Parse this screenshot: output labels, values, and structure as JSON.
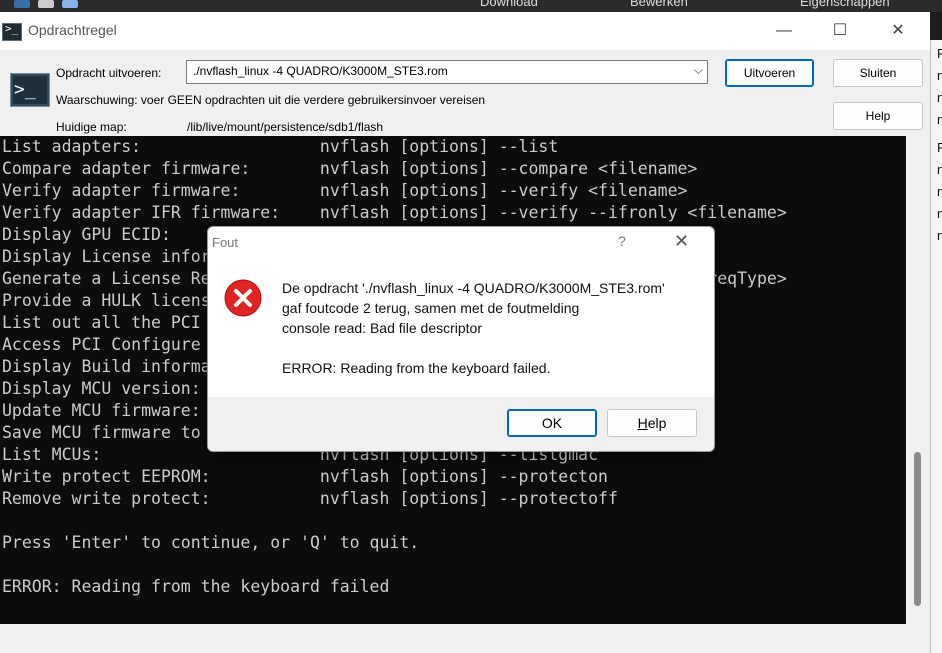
{
  "background": {
    "taskbar_items": [
      "Download",
      "Bewerken",
      "Eigenschappen"
    ],
    "right_window_letters": [
      "R",
      "n",
      "n",
      "n",
      "F",
      "n",
      "n",
      "n",
      "n"
    ]
  },
  "window": {
    "title": "Opdrachtregel",
    "minimize_icon": "—",
    "maximize_icon": "☐",
    "close_icon": "✕"
  },
  "form": {
    "run_label": "Opdracht uitvoeren:",
    "command_value": "./nvflash_linux -4 QUADRO/K3000M_STE3.rom",
    "warning": "Waarschuwing: voer GEEN opdrachten uit die verdere gebruikersinvoer vereisen",
    "dir_label": "Huidige map:",
    "dir_value": "/lib/live/mount/persistence/sdb1/flash",
    "run_button": "Uitvoeren",
    "close_button": "Sluiten",
    "help_button": "Help"
  },
  "terminal": {
    "lines": [
      "List adapters:                  nvflash [options] --list",
      "Compare adapter firmware:       nvflash [options] --compare <filename>",
      "Verify adapter firmware:        nvflash [options] --verify <filename>",
      "Verify adapter IFR firmware:    nvflash [options] --verify --ifronly <filename>",
      "Display GPU ECID:               nvflash [options] --ecid",
      "Display License information:    nvflash [options] --licinfo <filename>",
      "Generate a License Request:     nvflash [options] --licreq <filename>,<reqType>",
      "Provide a HULK license:         nvflash [options] --license <filename>",
      "List out all the PCI devices:   nvflash [options] --lspci",
      "Access PCI Configure Space:     nvflash [options] --setpci",
      "Display Build information:      nvflash [options] --buildinfo",
      "Display MCU version:            nvflash [options] --version",
      "Update MCU firmware:            nvflash [options] --upgradegmac",
      "Save MCU firmware to file:      nvflash [options] --savegmac",
      "List MCUs:                      nvflash [options] --listgmac",
      "Write protect EEPROM:           nvflash [options] --protecton",
      "Remove write protect:           nvflash [options] --protectoff",
      "",
      "Press 'Enter' to continue, or 'Q' to quit.",
      "",
      "ERROR: Reading from the keyboard failed"
    ]
  },
  "dialog": {
    "title": "Fout",
    "help_icon": "?",
    "close_icon": "✕",
    "message_lines": [
      "De opdracht './nvflash_linux -4 QUADRO/K3000M_STE3.rom'",
      "gaf foutcode 2 terug, samen met de foutmelding",
      "console read: Bad file descriptor",
      "",
      "ERROR: Reading from the keyboard failed."
    ],
    "ok_button": "OK",
    "help_button_prefix": "H",
    "help_button_rest": "elp"
  },
  "colors": {
    "terminal_bg": "#0c0c0c",
    "terminal_fg": "#cccccc",
    "accent": "#0067c0",
    "error_red": "#e02424"
  }
}
